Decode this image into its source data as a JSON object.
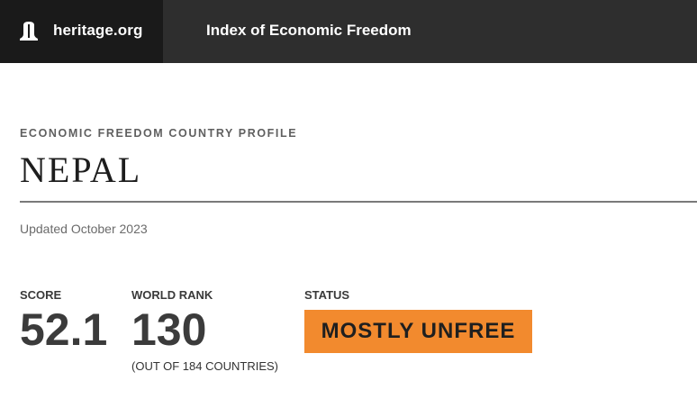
{
  "header": {
    "brand": "heritage.org",
    "section_title": "Index of Economic Freedom",
    "logo_icon": "liberty-bell-icon"
  },
  "profile": {
    "eyebrow": "ECONOMIC FREEDOM COUNTRY PROFILE",
    "country": "NEPAL",
    "updated": "Updated October 2023"
  },
  "stats": {
    "score_label": "SCORE",
    "score_value": "52.1",
    "rank_label": "WORLD RANK",
    "rank_value": "130",
    "rank_note": "(OUT OF 184 COUNTRIES)",
    "status_label": "STATUS",
    "status_value": "MOSTLY UNFREE"
  },
  "colors": {
    "topbar": "#2e2e2e",
    "brand_block": "#1a1a1a",
    "status_badge": "#f28a2e"
  }
}
